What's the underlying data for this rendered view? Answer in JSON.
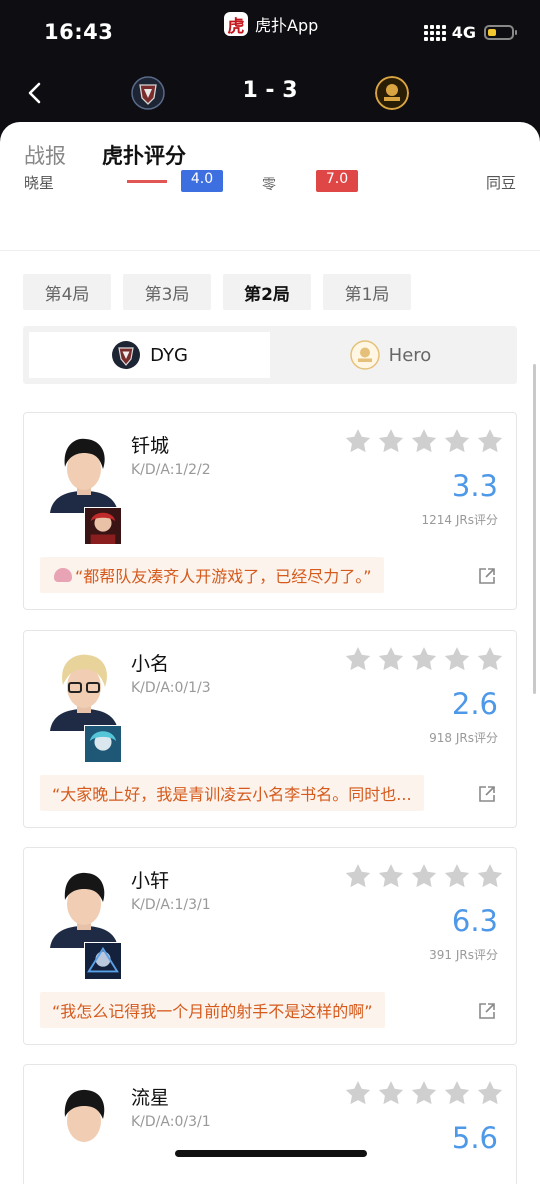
{
  "status_bar": {
    "time": "16:43",
    "app_name": "虎扑App",
    "app_badge": "虎",
    "network": "4G"
  },
  "match_header": {
    "score": "1 - 3",
    "back_icon": "chevron-left-icon",
    "team_left_logo": "dyg-logo",
    "team_right_logo": "hero-logo"
  },
  "tabs": [
    {
      "label": "战报",
      "active": false
    },
    {
      "label": "虎扑评分",
      "active": true
    }
  ],
  "peek_row": {
    "left": "晓星",
    "left_value": "4.0",
    "right_value": "7.0",
    "right": "同豆",
    "mid": "零"
  },
  "games": [
    {
      "label": "第4局",
      "active": false
    },
    {
      "label": "第3局",
      "active": false
    },
    {
      "label": "第2局",
      "active": true
    },
    {
      "label": "第1局",
      "active": false
    }
  ],
  "teams": [
    {
      "name": "DYG",
      "active": true,
      "color": "#2d3a5a"
    },
    {
      "name": "Hero",
      "active": false,
      "color": "#d9a441"
    }
  ],
  "players": [
    {
      "name": "钎城",
      "kda": "K/D/A:1/2/2",
      "rating": "3.3",
      "votes": "1214 JRs评分",
      "quote": "“都帮队友凑齐人开游戏了，已经尽力了。”",
      "stars_filled": 0
    },
    {
      "name": "小名",
      "kda": "K/D/A:0/1/3",
      "rating": "2.6",
      "votes": "918 JRs评分",
      "quote": "“大家晚上好，我是青训凌云小名李书名。同时也...",
      "stars_filled": 0
    },
    {
      "name": "小轩",
      "kda": "K/D/A:1/3/1",
      "rating": "6.3",
      "votes": "391 JRs评分",
      "quote": "“我怎么记得我一个月前的射手不是这样的啊”",
      "stars_filled": 0
    },
    {
      "name": "流星",
      "kda": "K/D/A:0/3/1",
      "rating": "5.6",
      "votes": "",
      "quote": "",
      "stars_filled": 0
    }
  ],
  "colors": {
    "accent_blue": "#4e98e8",
    "quote_text": "#d55a1c",
    "quote_bg": "#fcf3ec",
    "star_empty": "#cfcfcf",
    "header_bg": "#0e0e12"
  }
}
